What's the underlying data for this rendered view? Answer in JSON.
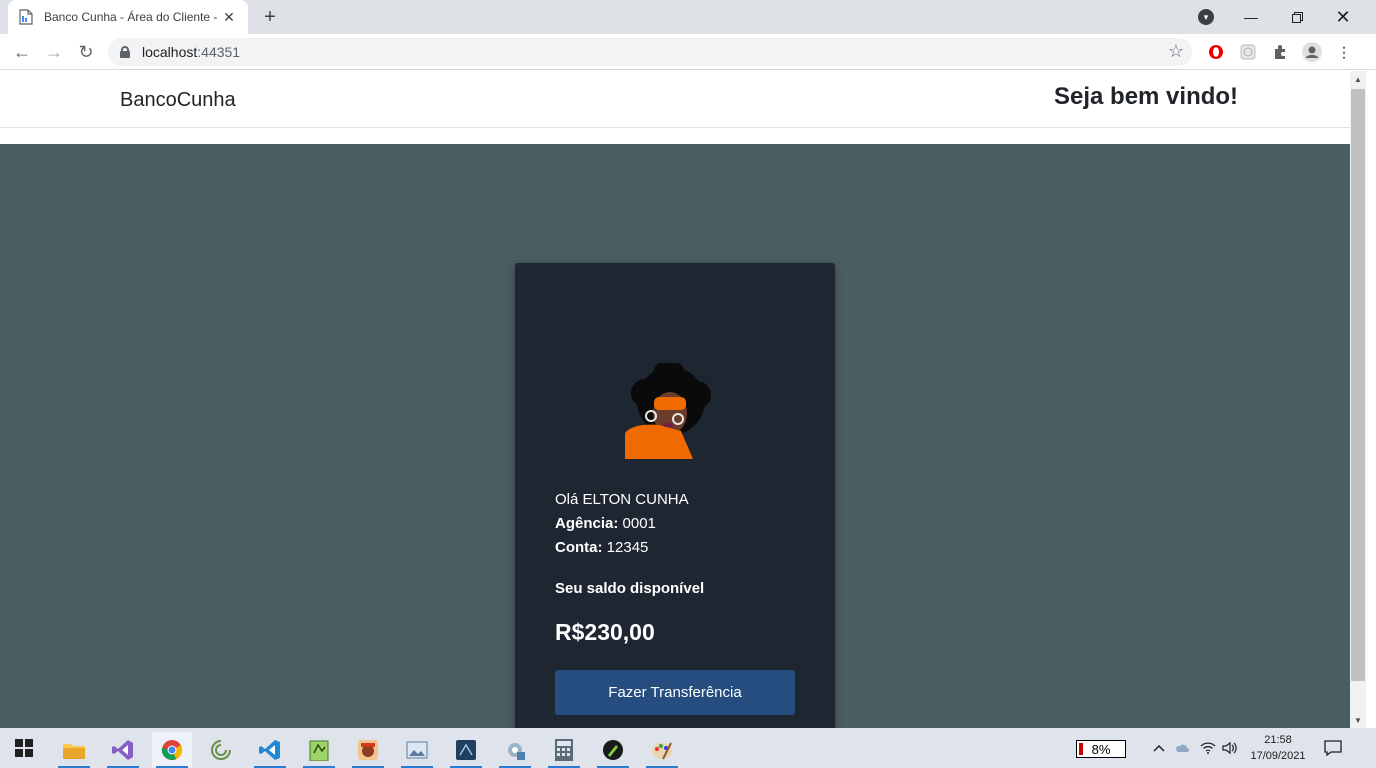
{
  "browser": {
    "tab_title": "Banco Cunha - Área do Cliente -",
    "url_host": "localhost",
    "url_port": ":44351"
  },
  "site": {
    "brand": "BancoCunha",
    "welcome": "Seja bem vindo!"
  },
  "account": {
    "greeting": "Olá ELTON CUNHA",
    "agencia_label": "Agência:",
    "agencia_value": "0001",
    "conta_label": "Conta:",
    "conta_value": "12345",
    "saldo_label": "Seu saldo disponível",
    "saldo_value": "R$230,00",
    "transfer_button": "Fazer Transferência"
  },
  "taskbar": {
    "battery_percent": "8%",
    "battery_level": 0.08,
    "time": "21:58",
    "date": "17/09/2021",
    "apps": [
      "file-explorer",
      "visual-studio",
      "chrome",
      "app",
      "vscode",
      "notepad-plus",
      "manga-app",
      "image-viewer",
      "sql-tool",
      "settings-tool",
      "calculator",
      "tool",
      "paint"
    ]
  },
  "colors": {
    "page_bg": "#4a5d63",
    "card_bg": "#1e2731",
    "button_bg": "#264d80",
    "avatar_orange": "#f06a00"
  }
}
